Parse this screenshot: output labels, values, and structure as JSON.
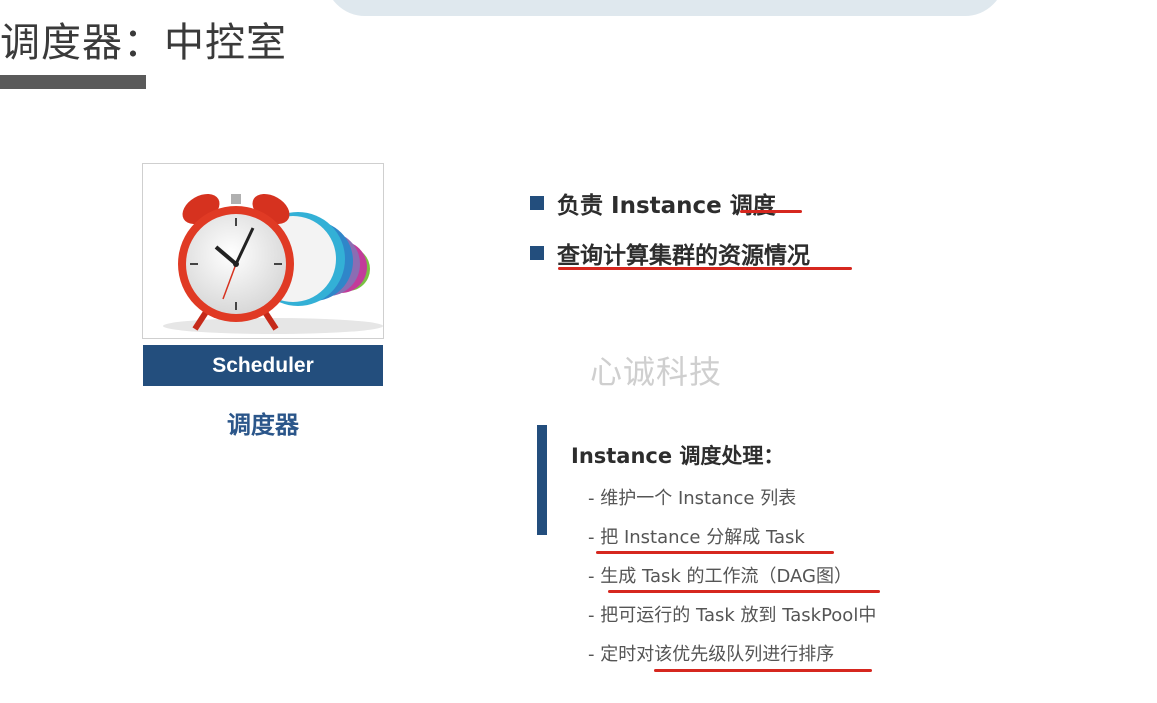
{
  "page": {
    "title": "调度器：中控室"
  },
  "card": {
    "label": "Scheduler",
    "caption": "调度器"
  },
  "bullets": [
    {
      "text": "负责 Instance 调度"
    },
    {
      "text": "查询计算集群的资源情况"
    }
  ],
  "watermark": "心诚科技",
  "section": {
    "heading": "Instance 调度处理：",
    "items": [
      "- 维护一个 Instance 列表",
      "- 把 Instance 分解成 Task",
      "- 生成 Task 的工作流（DAG图）",
      "- 把可运行的 Task 放到 TaskPool中",
      "- 定时对该优先级队列进行排序"
    ]
  },
  "colors": {
    "accent": "#234e7d",
    "underline": "#d6271f"
  }
}
